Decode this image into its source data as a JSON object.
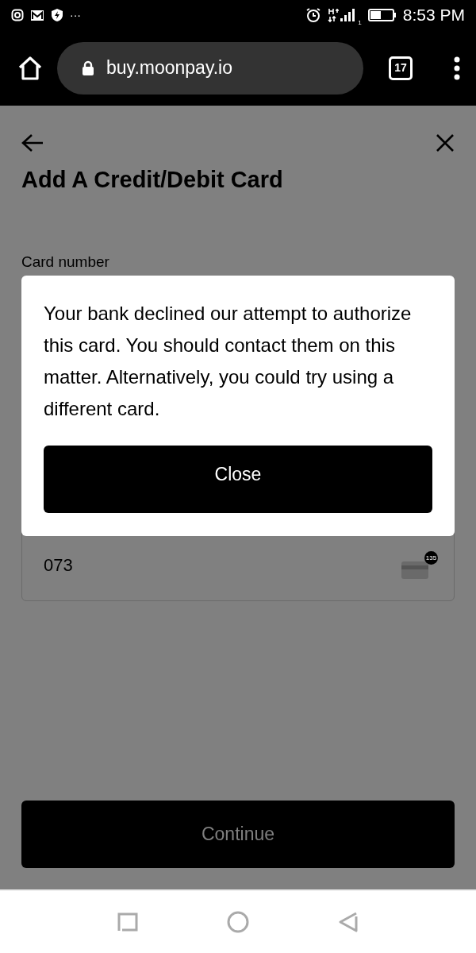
{
  "status_bar": {
    "time": "8:53 PM",
    "more": "···",
    "sim_index": "1"
  },
  "browser": {
    "url": "buy.moonpay.io",
    "tab_count": "17"
  },
  "page": {
    "title": "Add A Credit/Debit Card",
    "card_number_label": "Card number",
    "cvv_value": "073",
    "cvv_hint": "135",
    "continue_button": {
      "label": "Continue",
      "disabled": true
    }
  },
  "dialog": {
    "message": "Your bank declined our attempt to authorize this card. You should contact them on this matter. Alternatively, you could try using a different card.",
    "button": "Close"
  }
}
